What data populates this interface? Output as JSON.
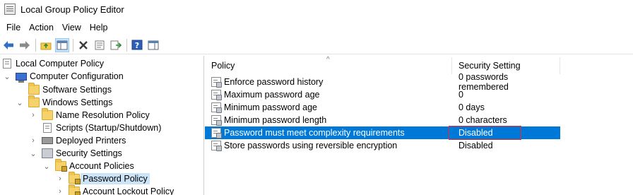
{
  "window": {
    "title": "Local Group Policy Editor"
  },
  "menu": [
    "File",
    "Action",
    "View",
    "Help"
  ],
  "toolbar": {
    "buttons": [
      {
        "icon": "back-arrow-icon"
      },
      {
        "icon": "forward-arrow-icon"
      },
      {
        "icon": "up-folder-icon"
      },
      {
        "icon": "show-hide-console-tree-icon",
        "active": true
      },
      {
        "icon": "delete-icon"
      },
      {
        "icon": "properties-icon"
      },
      {
        "icon": "export-list-icon"
      },
      {
        "icon": "help-icon"
      },
      {
        "icon": "show-hide-action-pane-icon"
      }
    ]
  },
  "tree": {
    "items": [
      {
        "label": "Local Computer Policy",
        "icon": "policy-doc-icon",
        "chevron": ""
      },
      {
        "label": "Computer Configuration",
        "icon": "computer-icon",
        "chevron": "down"
      },
      {
        "label": "Software Settings",
        "icon": "folder-icon",
        "chevron": ""
      },
      {
        "label": "Windows Settings",
        "icon": "folder-icon",
        "chevron": "down"
      },
      {
        "label": "Name Resolution Policy",
        "icon": "folder-icon",
        "chevron": "right"
      },
      {
        "label": "Scripts (Startup/Shutdown)",
        "icon": "script-doc-icon",
        "chevron": ""
      },
      {
        "label": "Deployed Printers",
        "icon": "printer-icon",
        "chevron": "right"
      },
      {
        "label": "Security Settings",
        "icon": "security-settings-icon",
        "chevron": "down"
      },
      {
        "label": "Account Policies",
        "icon": "locked-folder-icon",
        "chevron": "down"
      },
      {
        "label": "Password Policy",
        "icon": "locked-folder-icon",
        "chevron": "right",
        "selected": true
      },
      {
        "label": "Account Lockout Policy",
        "icon": "locked-folder-icon",
        "chevron": "right"
      }
    ]
  },
  "list": {
    "columns": {
      "policy": "Policy",
      "setting": "Security Setting"
    },
    "rows": [
      {
        "policy": "Enforce password history",
        "setting": "0 passwords remembered"
      },
      {
        "policy": "Maximum password age",
        "setting": "0"
      },
      {
        "policy": "Minimum password age",
        "setting": "0 days"
      },
      {
        "policy": "Minimum password length",
        "setting": "0 characters"
      },
      {
        "policy": "Password must meet complexity requirements",
        "setting": "Disabled",
        "selected": true
      },
      {
        "policy": "Store passwords using reversible encryption",
        "setting": "Disabled"
      }
    ]
  },
  "colors": {
    "selection": "#0078d7",
    "tree_selection": "#cce4f7",
    "highlight_box": "#e03030"
  }
}
